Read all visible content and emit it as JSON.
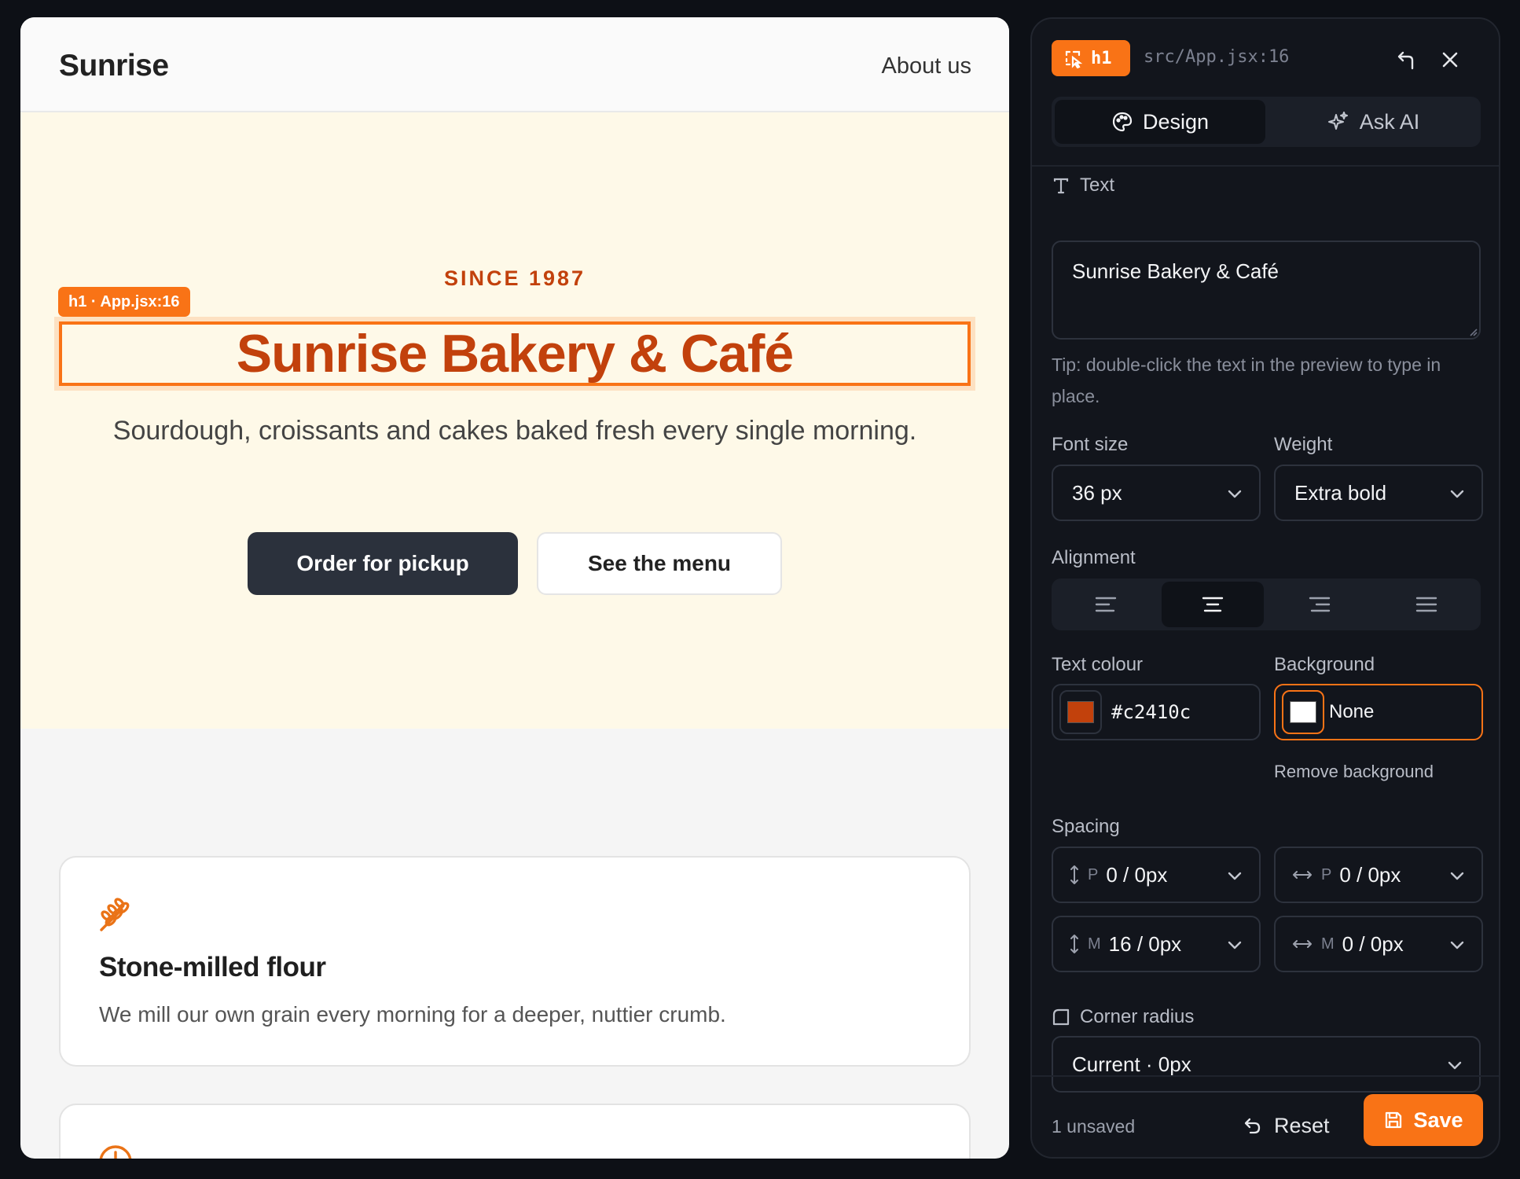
{
  "preview": {
    "brand": "Sunrise",
    "nav_link": "About us",
    "eyebrow": "SINCE 1987",
    "selection_tag": "h1 · App.jsx:16",
    "heading": "Sunrise Bakery & Café",
    "tagline": "Sourdough, croissants and cakes baked fresh every single morning.",
    "primary_cta": "Order for pickup",
    "secondary_cta": "See the menu",
    "features": [
      {
        "icon": "wheat-icon",
        "title": "Stone-milled flour",
        "description": "We mill our own grain every morning for a deeper, nuttier crumb."
      },
      {
        "icon": "clock-icon"
      }
    ]
  },
  "inspector": {
    "element_tag": "h1",
    "source": "src/App.jsx:16",
    "tabs": [
      {
        "label": "Design",
        "icon": "palette-icon",
        "active": true
      },
      {
        "label": "Ask AI",
        "icon": "sparkles-icon",
        "active": false
      }
    ],
    "text_section": {
      "label": "Text",
      "value": "Sunrise Bakery & Café",
      "tip": "Tip: double-click the text in the preview to type in place."
    },
    "font_size": {
      "label": "Font size",
      "value": "36 px"
    },
    "weight": {
      "label": "Weight",
      "value": "Extra bold"
    },
    "alignment": {
      "label": "Alignment",
      "options": [
        "left",
        "center",
        "right",
        "justify"
      ],
      "selected": "center"
    },
    "text_colour": {
      "label": "Text colour",
      "value": "#c2410c",
      "swatch": "#c2410c"
    },
    "background": {
      "label": "Background",
      "value": "None",
      "swatch": "#ffffff",
      "remove_label": "Remove background"
    },
    "spacing": {
      "label": "Spacing",
      "fields": [
        {
          "prefix": "P",
          "value": "0 / 0px",
          "axis": "vertical"
        },
        {
          "prefix": "P",
          "value": "0 / 0px",
          "axis": "horizontal"
        },
        {
          "prefix": "M",
          "value": "16 / 0px",
          "axis": "vertical"
        },
        {
          "prefix": "M",
          "value": "0 / 0px",
          "axis": "horizontal"
        }
      ]
    },
    "corner_radius": {
      "label": "Corner radius",
      "value": "Current · 0px"
    },
    "footer": {
      "status": "1 unsaved",
      "reset_label": "Reset",
      "save_label": "Save"
    }
  },
  "colors": {
    "accent": "#f97316",
    "heading": "#c2410c",
    "hero_bg": "#fef9e8",
    "panel_bg": "#12151c",
    "button_dark": "#2b313c"
  }
}
